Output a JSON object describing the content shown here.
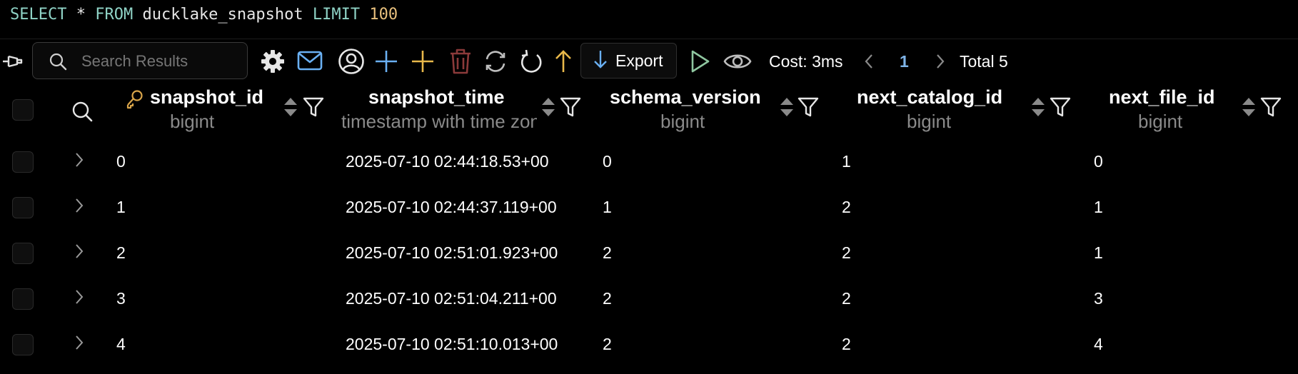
{
  "query": {
    "select_kw": "SELECT",
    "star": " * ",
    "from_kw": "FROM",
    "table": " ducklake_snapshot ",
    "limit_kw": "LIMIT",
    "limit_value": " 100"
  },
  "toolbar": {
    "search_placeholder": "Search Results",
    "export_label": "Export",
    "cost": "Cost: 3ms",
    "page": "1",
    "total": "Total 5",
    "icons": [
      "pin-icon",
      "gear-icon",
      "mail-icon",
      "user-circle-icon",
      "plus-blue-icon",
      "plus-yellow-icon",
      "trash-icon",
      "sync-icon",
      "refresh-icon",
      "arrow-up-icon",
      "arrow-down-icon",
      "play-icon",
      "eye-icon"
    ]
  },
  "colors": {
    "keyword": "#8fd3c6",
    "number": "#e8c07d",
    "accent_blue": "#6ab0f3",
    "accent_yellow": "#e8b84a",
    "trash": "#8b3a3a",
    "play": "#8fc7a0",
    "page_active": "#7fb4e8"
  },
  "columns": [
    {
      "name": "snapshot_id",
      "type": "bigint"
    },
    {
      "name": "snapshot_time",
      "type": "timestamp with time zone"
    },
    {
      "name": "schema_version",
      "type": "bigint"
    },
    {
      "name": "next_catalog_id",
      "type": "bigint"
    },
    {
      "name": "next_file_id",
      "type": "bigint"
    }
  ],
  "rows": [
    {
      "snapshot_id": "0",
      "snapshot_time": "2025-07-10 02:44:18.53+00",
      "schema_version": "0",
      "next_catalog_id": "1",
      "next_file_id": "0"
    },
    {
      "snapshot_id": "1",
      "snapshot_time": "2025-07-10 02:44:37.119+00",
      "schema_version": "1",
      "next_catalog_id": "2",
      "next_file_id": "1"
    },
    {
      "snapshot_id": "2",
      "snapshot_time": "2025-07-10 02:51:01.923+00",
      "schema_version": "2",
      "next_catalog_id": "2",
      "next_file_id": "1"
    },
    {
      "snapshot_id": "3",
      "snapshot_time": "2025-07-10 02:51:04.211+00",
      "schema_version": "2",
      "next_catalog_id": "2",
      "next_file_id": "3"
    },
    {
      "snapshot_id": "4",
      "snapshot_time": "2025-07-10 02:51:10.013+00",
      "schema_version": "2",
      "next_catalog_id": "2",
      "next_file_id": "4"
    }
  ]
}
